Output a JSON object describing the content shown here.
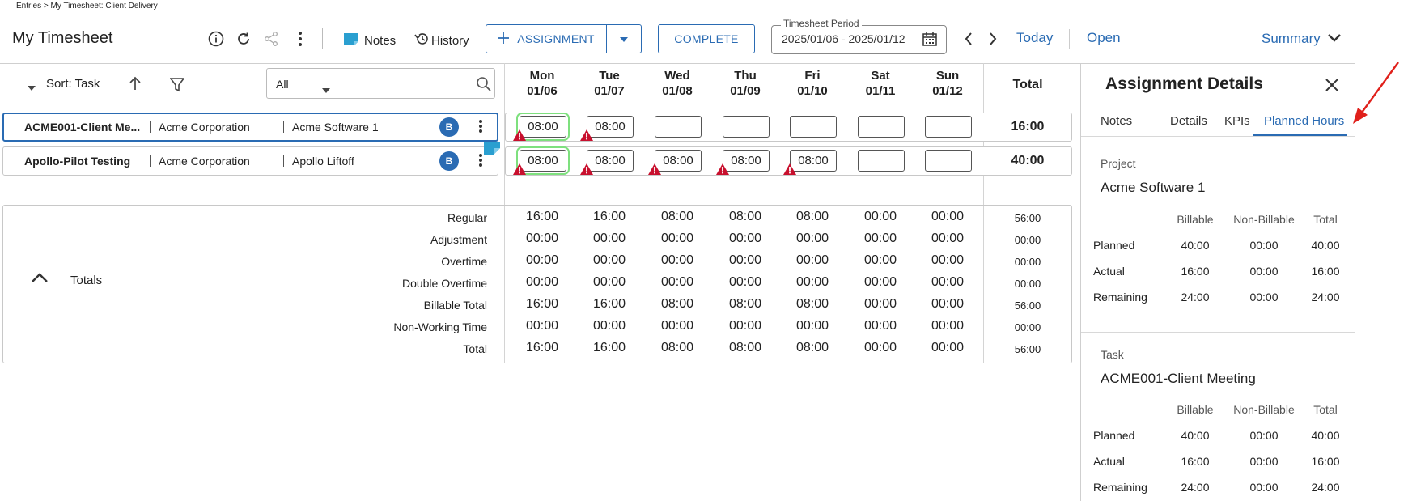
{
  "breadcrumb": "Entries > My Timesheet: Client Delivery",
  "page_title": "My Timesheet",
  "toolbar": {
    "notes_label": "Notes",
    "history_label": "History",
    "assignment_label": "ASSIGNMENT",
    "complete_label": "COMPLETE",
    "period_legend": "Timesheet Period",
    "period_value": "2025/01/06 - 2025/01/12",
    "today_label": "Today",
    "open_label": "Open",
    "summary_label": "Summary"
  },
  "grid": {
    "sort_label": "Sort: Task",
    "filter_value": "All",
    "total_header": "Total",
    "days": [
      {
        "name": "Mon",
        "date": "01/06"
      },
      {
        "name": "Tue",
        "date": "01/07"
      },
      {
        "name": "Wed",
        "date": "01/08"
      },
      {
        "name": "Thu",
        "date": "01/09"
      },
      {
        "name": "Fri",
        "date": "01/10"
      },
      {
        "name": "Sat",
        "date": "01/11"
      },
      {
        "name": "Sun",
        "date": "01/12"
      }
    ],
    "rows": [
      {
        "task": "ACME001-Client Me...",
        "client": "Acme Corporation",
        "project": "Acme Software 1",
        "badge": "B",
        "hours": [
          "08:00",
          "08:00",
          "",
          "",
          "",
          "",
          ""
        ],
        "total": "16:00"
      },
      {
        "task": "Apollo-Pilot Testing",
        "client": "Acme Corporation",
        "project": "Apollo Liftoff",
        "badge": "B",
        "hours": [
          "08:00",
          "08:00",
          "08:00",
          "08:00",
          "08:00",
          "",
          ""
        ],
        "total": "40:00"
      }
    ]
  },
  "totals": {
    "label": "Totals",
    "rows": [
      {
        "label": "Regular",
        "values": [
          "16:00",
          "16:00",
          "08:00",
          "08:00",
          "08:00",
          "00:00",
          "00:00"
        ],
        "total": "56:00"
      },
      {
        "label": "Adjustment",
        "values": [
          "00:00",
          "00:00",
          "00:00",
          "00:00",
          "00:00",
          "00:00",
          "00:00"
        ],
        "total": "00:00"
      },
      {
        "label": "Overtime",
        "values": [
          "00:00",
          "00:00",
          "00:00",
          "00:00",
          "00:00",
          "00:00",
          "00:00"
        ],
        "total": "00:00"
      },
      {
        "label": "Double Overtime",
        "values": [
          "00:00",
          "00:00",
          "00:00",
          "00:00",
          "00:00",
          "00:00",
          "00:00"
        ],
        "total": "00:00"
      },
      {
        "label": "Billable Total",
        "values": [
          "16:00",
          "16:00",
          "08:00",
          "08:00",
          "08:00",
          "00:00",
          "00:00"
        ],
        "total": "56:00"
      },
      {
        "label": "Non-Working Time",
        "values": [
          "00:00",
          "00:00",
          "00:00",
          "00:00",
          "00:00",
          "00:00",
          "00:00"
        ],
        "total": "00:00"
      },
      {
        "label": "Total",
        "values": [
          "16:00",
          "16:00",
          "08:00",
          "08:00",
          "08:00",
          "00:00",
          "00:00"
        ],
        "total": "56:00"
      }
    ]
  },
  "details": {
    "title": "Assignment Details",
    "tabs": [
      "Notes",
      "Details",
      "KPIs",
      "Planned Hours"
    ],
    "active_tab": "Planned Hours",
    "columns": [
      "Billable",
      "Non-Billable",
      "Total"
    ],
    "project": {
      "label": "Project",
      "value": "Acme Software 1",
      "rows": [
        {
          "label": "Planned",
          "values": [
            "40:00",
            "00:00",
            "40:00"
          ]
        },
        {
          "label": "Actual",
          "values": [
            "16:00",
            "00:00",
            "16:00"
          ]
        },
        {
          "label": "Remaining",
          "values": [
            "24:00",
            "00:00",
            "24:00"
          ]
        }
      ]
    },
    "task": {
      "label": "Task",
      "value": "ACME001-Client Meeting",
      "rows": [
        {
          "label": "Planned",
          "values": [
            "40:00",
            "00:00",
            "40:00"
          ]
        },
        {
          "label": "Actual",
          "values": [
            "16:00",
            "00:00",
            "16:00"
          ]
        },
        {
          "label": "Remaining",
          "values": [
            "24:00",
            "00:00",
            "24:00"
          ]
        }
      ]
    }
  },
  "colors": {
    "accent": "#2a6bb3",
    "warning": "#c8102e",
    "focus": "#7ee07e",
    "annotation_arrow": "#e0201b"
  }
}
